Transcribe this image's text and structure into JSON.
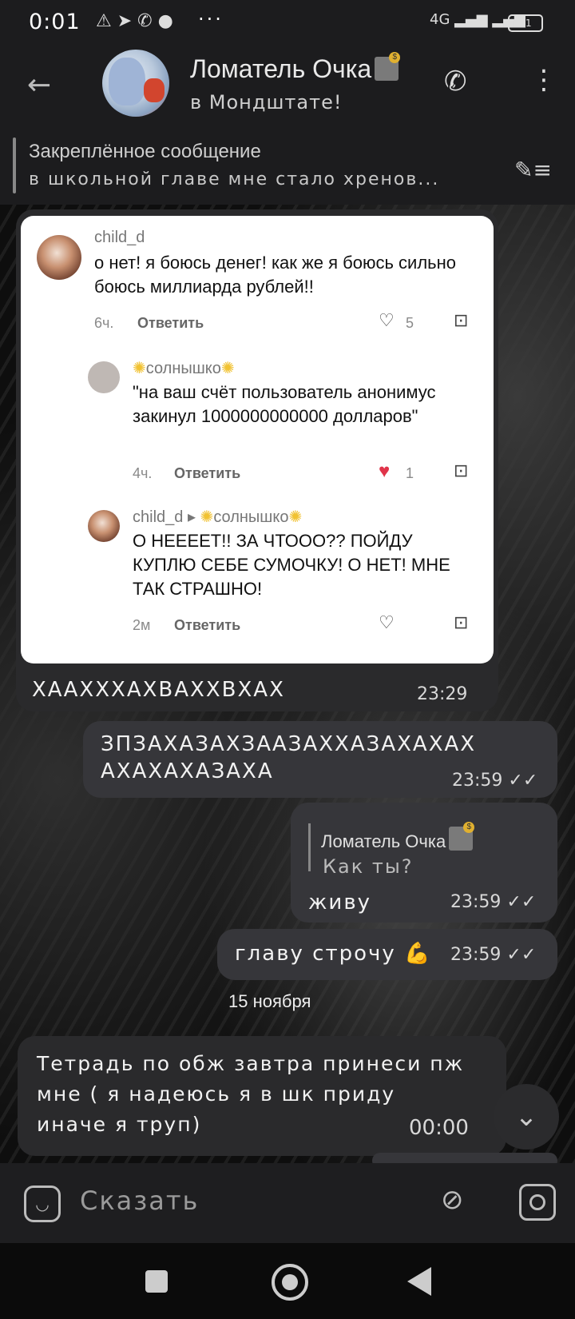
{
  "status_bar": {
    "time": "0:01",
    "icons": "⚠ ➤ ✆ ●",
    "dots": "···",
    "network": "4G ▂▄▆ ▂▄▆",
    "battery": "11"
  },
  "header": {
    "title": "Ломатель Очка",
    "subtitle": "в Мондштате!"
  },
  "pinned": {
    "title": "Закреплённое сообщение",
    "text": "в школьной главе мне стало хренов..."
  },
  "comments": [
    {
      "user": "child_d",
      "text": "о нет! я боюсь денег! как же я боюсь сильно боюсь миллиарда рублей!!",
      "age": "6ч.",
      "reply": "Ответить",
      "likes": "5"
    },
    {
      "user": "солнышко",
      "text": "\"на ваш счёт пользователь анонимус закинул 1000000000000 долларов\"",
      "age": "4ч.",
      "reply": "Ответить",
      "likes": "1"
    },
    {
      "user": "child_d",
      "reply_to": "солнышко",
      "text": "О НЕЕЕЕТ!! ЗА ЧТООО?? ПОЙДУ КУПЛЮ СЕБЕ СУМОЧКУ! О НЕТ! МНЕ ТАК СТРАШНО!",
      "age": "2м",
      "reply": "Ответить"
    }
  ],
  "messages": [
    {
      "text": "ХААХХХАХВАХХВХАХ",
      "time": "23:29"
    },
    {
      "text": "ЗПЗАХАЗАХЗААЗАХХАЗАХАХАХ АХАХАХАЗАХА",
      "time": "23:59"
    },
    {
      "quote_author": "Ломатель Очка",
      "quote_text": "Как ты?",
      "text": "живу",
      "time": "23:59"
    },
    {
      "text": "главу строчу",
      "time": "23:59"
    },
    {
      "text": "Тетрадь по обж завтра принеси пж мне ( я надеюсь я в шк приду иначе я труп)",
      "time": "00:00"
    }
  ],
  "date_badge": "15 ноября",
  "input": {
    "placeholder": "Сказать"
  },
  "colors": {
    "like_red": "#e0344a",
    "sun": "#f1c232"
  }
}
